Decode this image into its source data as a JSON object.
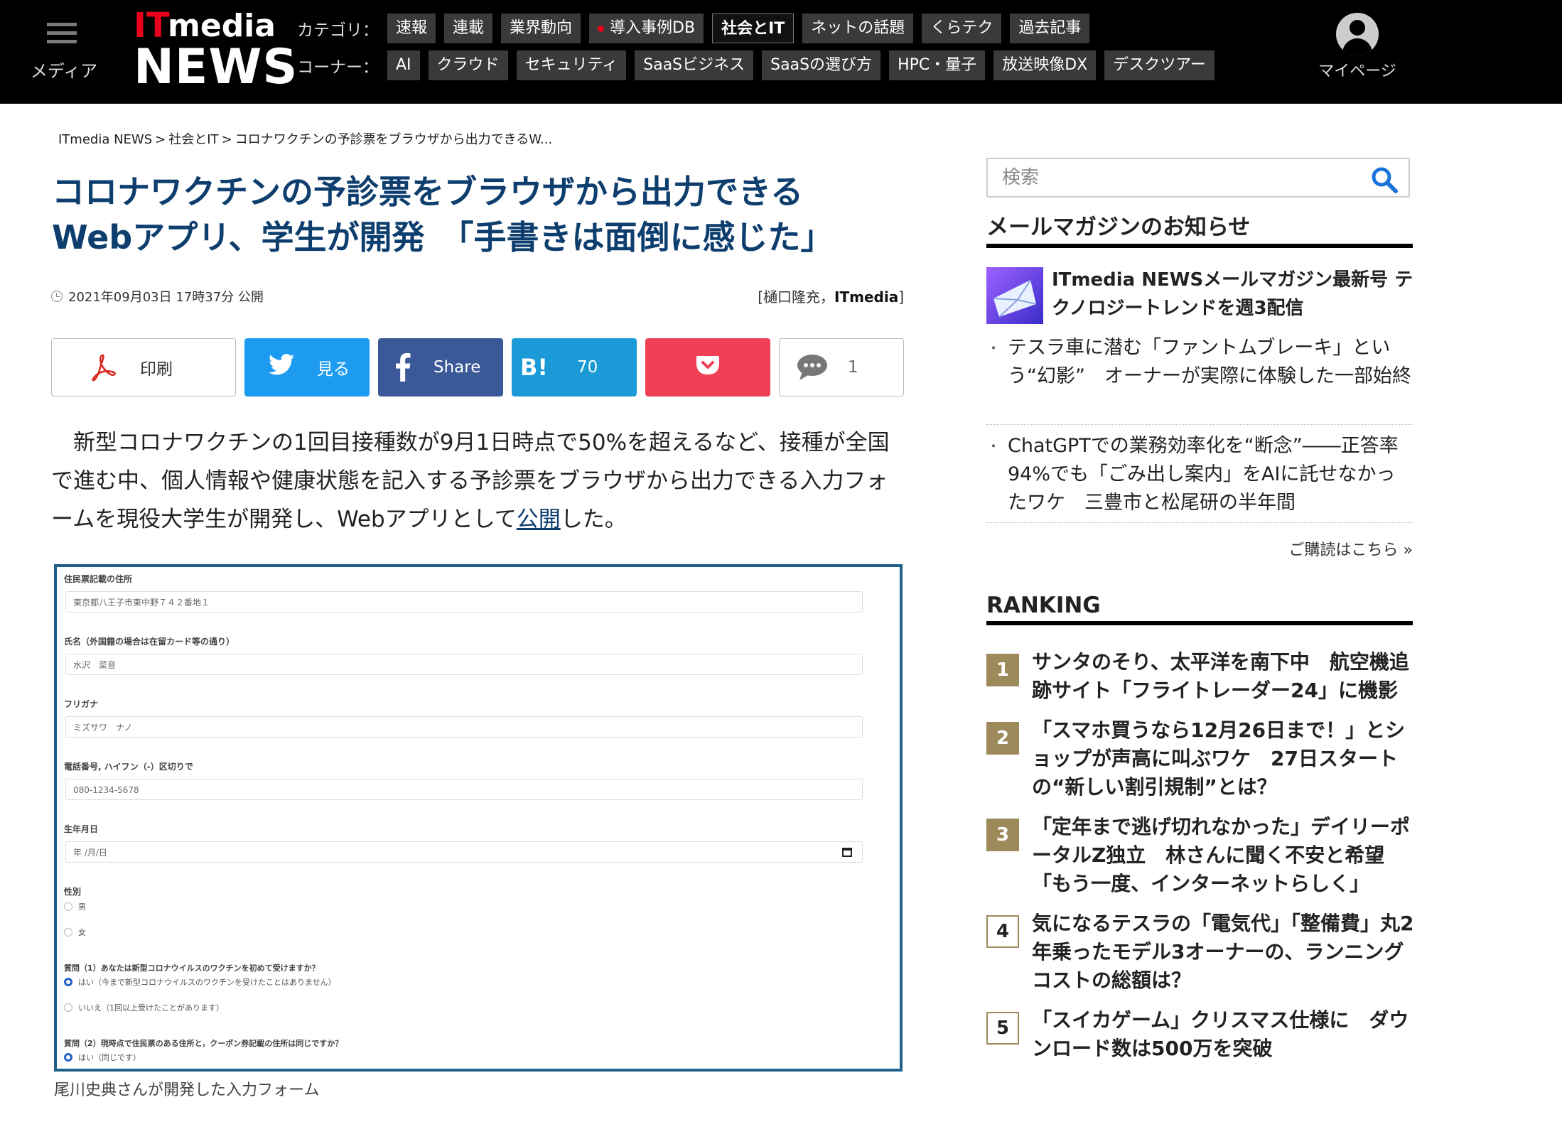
{
  "header": {
    "menu_label": "メディア",
    "logo_it": "IT",
    "logo_media": "media",
    "logo_news": "NEWS",
    "category_label": "カテゴリ：",
    "categories": [
      "速報",
      "連載",
      "業界動向",
      "導入事例DB",
      "社会とIT",
      "ネットの話題",
      "くらテク",
      "過去記事"
    ],
    "active_category": "社会とIT",
    "corner_label": "コーナー：",
    "corners": [
      "AI",
      "クラウド",
      "セキュリティ",
      "SaaSビジネス",
      "SaaSの選び方",
      "HPC・量子",
      "放送映像DX",
      "デスクツアー"
    ],
    "mypage_label": "マイページ"
  },
  "breadcrumb": [
    "ITmedia NEWS",
    "社会とIT",
    "コロナワクチンの予診票をブラウザから出力できるW..."
  ],
  "article": {
    "title_line1": "コロナワクチンの予診票をブラウザから出力できる",
    "title_line2": "Webアプリ、学生が開発　「手書きは面倒に感じた」",
    "date": "2021年09月03日 17時37分 公開",
    "byline_author": "[樋口隆充，",
    "byline_source": "ITmedia",
    "byline_close": "]",
    "lead_before": "新型コロナワクチンの1回目接種数が9月1日時点で50%を超えるなど、接種が全国で進む中、個人情報や健康状態を記入する予診票をブラウザから出力できる入力フォームを現役大学生が開発し、Webアプリとして",
    "lead_link": "公開",
    "lead_after": "した。",
    "caption": "尾川史典さんが開発した入力フォーム"
  },
  "share": {
    "print": "印刷",
    "twitter": "見る",
    "facebook": "Share",
    "hatena_logo": "B!",
    "hatena_count": "70",
    "comment_count": "1"
  },
  "form": {
    "address_label": "住民票記載の住所",
    "address_value": "東京都八王子市東中野７４２番地１",
    "name_label": "氏名（外国籍の場合は在留カード等の通り）",
    "name_value": "水沢　菜音",
    "kana_label": "フリガナ",
    "kana_value": "ミズサワ　ナノ",
    "phone_label": "電話番号, ハイフン（-）区切りで",
    "phone_value": "080-1234-5678",
    "birth_label": "生年月日",
    "birth_value": "年 /月/日",
    "sex_label": "性別",
    "sex_options": [
      "男",
      "女"
    ],
    "q1_label": "質問（1）あなたは新型コロナウイルスのワクチンを初めて受けますか？",
    "q1_options": [
      "はい（今まで新型コロナウイルスのワクチンを受けたことはありません）",
      "いいえ（1回以上受けたことがあります）"
    ],
    "q2_label": "質問（2）現時点で住民票のある住所と，クーポン券記載の住所は同じですか？",
    "q2_options": [
      "はい（同じです）"
    ]
  },
  "sidebar": {
    "search_placeholder": "検索",
    "mail_heading": "メールマガジンのお知らせ",
    "mag_feature": "ITmedia NEWSメールマガジン最新号 テクノロジートレンドを週3配信",
    "mag_items": [
      "テスラ車に潜む「ファントムブレーキ」という“幻影”　オーナーが実際に体験した一部始終",
      "ChatGPTでの業務効率化を“断念”――正答率94%でも「ごみ出し案内」をAIに託せなかったワケ　三豊市と松尾研の半年間"
    ],
    "mag_more": "ご購読はこちら »",
    "ranking_heading": "RANKING",
    "ranking": [
      {
        "num": "1",
        "title": "サンタのそり、太平洋を南下中　航空機追跡サイト「フライトレーダー24」に機影"
      },
      {
        "num": "2",
        "title": "「スマホ買うなら12月26日まで！」とショップが声高に叫ぶワケ　27日スタートの“新しい割引規制”とは？"
      },
      {
        "num": "3",
        "title": "「定年まで逃げ切れなかった」デイリーポータルZ独立　林さんに聞く不安と希望「もう一度、インターネットらしく」"
      },
      {
        "num": "4",
        "title": "気になるテスラの「電気代」「整備費」丸2年乗ったモデル3オーナーの、ランニングコストの総額は？"
      },
      {
        "num": "5",
        "title": "「スイカゲーム」クリスマス仕様に　ダウンロード数は500万を突破"
      }
    ]
  },
  "colors": {
    "title": "#0e3e6e",
    "twitter": "#1d9bf0",
    "facebook": "#3b5998",
    "hatena": "#1a9ad6",
    "pocket": "#ef4056",
    "rank_accent": "#9c8a5a",
    "logo_red": "#e8001c"
  }
}
